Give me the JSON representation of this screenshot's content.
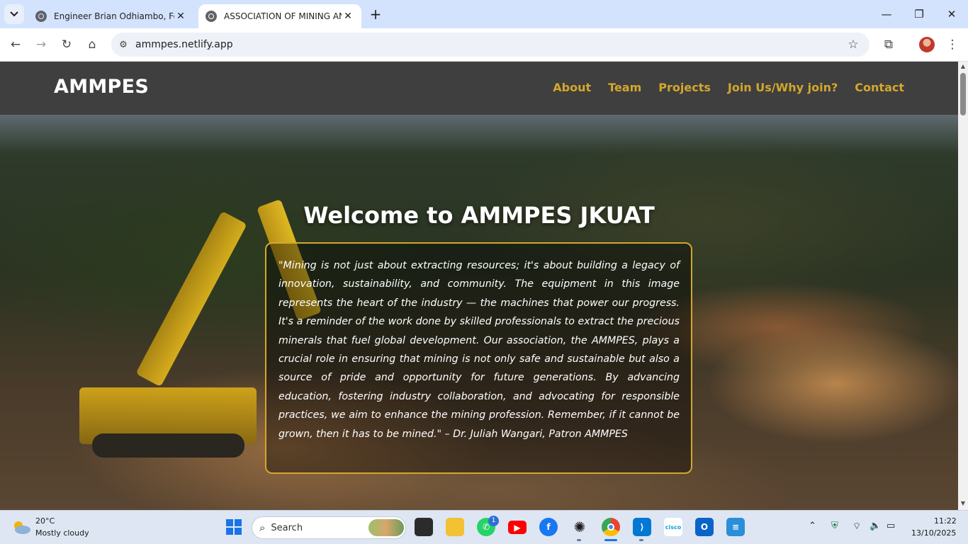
{
  "browser": {
    "tabs": [
      {
        "title": "Engineer Brian Odhiambo, Foun",
        "active": false
      },
      {
        "title": "ASSOCIATION OF MINING AND",
        "active": true
      }
    ],
    "new_tab_symbol": "+",
    "window_controls": {
      "minimize": "—",
      "restore": "❐",
      "close": "✕"
    },
    "url": "ammpes.netlify.app",
    "icons": [
      "tab-search-icon",
      "back-icon",
      "forward-icon",
      "reload-icon",
      "home-icon",
      "site-info-icon",
      "bookmark-star-icon",
      "extensions-icon",
      "profile-avatar",
      "menu-kebab-icon"
    ]
  },
  "site": {
    "brand": "AMMPES",
    "nav": [
      "About",
      "Team",
      "Projects",
      "Join Us/Why join?",
      "Contact"
    ],
    "hero_title": "Welcome to AMMPES JKUAT",
    "quote": "\"Mining is not just about extracting resources; it's about building a legacy of innovation, sustainability, and community. The equipment in this image represents the heart of the industry — the machines that power our progress. It's a reminder of the work done by skilled professionals to extract the precious minerals that fuel global development. Our association, the AMMPES, plays a crucial role in ensuring that mining is not only safe and sustainable but also a source of pride and opportunity for future generations. By advancing education, fostering industry collaboration, and advocating for responsible practices, we aim to enhance the mining profession. Remember, if it cannot be grown, then it has to be mined.\" – Dr. Juliah Wangari, Patron AMMPES",
    "colors": {
      "nav_bg": "#3f3f3f",
      "accent_gold": "#d4a72c",
      "text_white": "#ffffff"
    }
  },
  "taskbar": {
    "weather": {
      "temp": "20°C",
      "desc": "Mostly cloudy"
    },
    "search_placeholder": "Search",
    "whatsapp_badge": "1",
    "pinned_icons": [
      "windows-start-icon",
      "task-view-icon",
      "file-explorer-icon",
      "whatsapp-icon",
      "youtube-icon",
      "facebook-icon",
      "chatgpt-icon",
      "chrome-icon",
      "vscode-icon",
      "cisco-icon",
      "outlook-icon",
      "notepad-icon"
    ],
    "clock": {
      "time": "11:22",
      "date": "13/10/2025"
    }
  }
}
